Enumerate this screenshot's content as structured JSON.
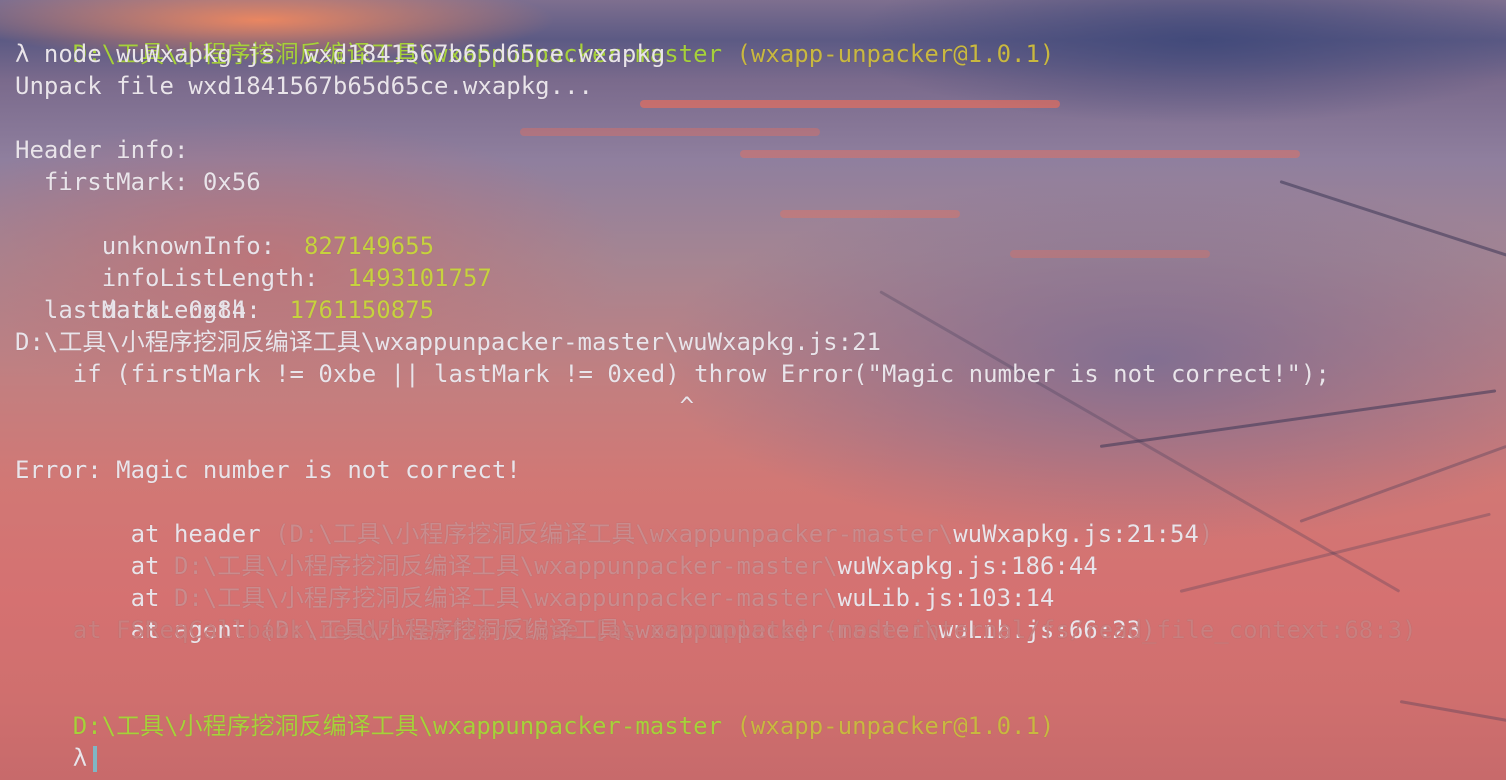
{
  "terminal": {
    "prompt1": {
      "path": "D:\\工具\\小程序挖洞反编译工具\\wxappunpacker-master",
      "pkg": " (wxapp-unpacker@1.0.1)"
    },
    "command": "λ node wuWxapkg.js  wxd1841567b65d65ce.wxapkg",
    "unpack": "Unpack file wxd1841567b65d65ce.wxapkg...",
    "header_info": "Header info:",
    "fields": {
      "first_mark_label": "  firstMark: 0x56",
      "unknown_info_label": "  unknownInfo:  ",
      "unknown_info_value": "827149655",
      "info_list_length_label": "  infoListLength:  ",
      "info_list_length_value": "1493101757",
      "data_length_label": "  dataLength:  ",
      "data_length_value": "1761150875",
      "last_mark_label": "  lastMark: 0x84"
    },
    "error_location": "D:\\工具\\小程序挖洞反编译工具\\wxappunpacker-master\\wuWxapkg.js:21",
    "error_source": "    if (firstMark != 0xbe || lastMark != 0xed) throw Error(\"Magic number is not correct!\");",
    "caret": "                                              ^",
    "error_message": "Error: Magic number is not correct!",
    "stack": {
      "s1_prefix": "    at header ",
      "s1_path": "(D:\\工具\\小程序挖洞反编译工具\\wxappunpacker-master\\",
      "s1_file": "wuWxapkg.js:21:54",
      "s1_close": ")",
      "s2_prefix": "    at ",
      "s2_path": "D:\\工具\\小程序挖洞反编译工具\\wxappunpacker-master\\",
      "s2_file": "wuWxapkg.js:186:44",
      "s3_prefix": "    at ",
      "s3_path": "D:\\工具\\小程序挖洞反编译工具\\wxappunpacker-master\\",
      "s3_file": "wuLib.js:103:14",
      "s4_prefix": "    at agent ",
      "s4_path": "(D:\\工具\\小程序挖洞反编译工具\\wxappunpacker-master\\",
      "s4_file": "wuLib.js:66:23",
      "s4_close": ")",
      "s5": "    at FSReqCallback.readFileAfterClose [as oncomplete] (node:internal/fs/read_file_context:68:3)"
    },
    "prompt2": {
      "path": "D:\\工具\\小程序挖洞反编译工具\\wxappunpacker-master",
      "pkg": " (wxapp-unpacker@1.0.1)"
    },
    "input_prompt": "λ",
    "colors": {
      "path_green": "#a6d13a",
      "pkg_yellow": "#c9b840",
      "text": "#e9e4ea",
      "cursor": "#7fb6c4"
    }
  }
}
